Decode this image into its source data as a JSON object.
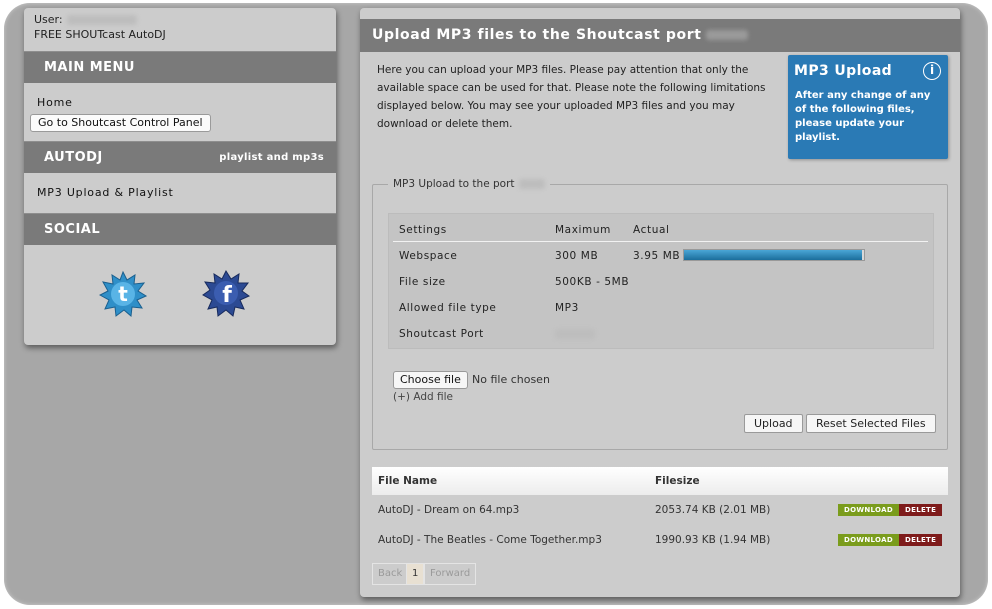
{
  "sidebar": {
    "user_label": "User:",
    "product": "FREE SHOUTcast AutoDJ",
    "main_menu_heading": "MAIN MENU",
    "home_link": "Home",
    "control_panel_button": "Go to Shoutcast Control Panel",
    "autodj_heading": "AUTODJ",
    "autodj_sub": "playlist and mp3s",
    "mp3_link": "MP3 Upload & Playlist",
    "social_heading": "SOCIAL",
    "social_icons": [
      "twitter-icon",
      "facebook-icon"
    ]
  },
  "main": {
    "title": "Upload MP3 files to the Shoutcast port",
    "intro": "Here you can upload your MP3 files. Please pay attention that only the available space can be used for that. Please note the following limitations displayed below. You may see your uploaded MP3 files and you may download or delete them.",
    "infobox": {
      "title": "MP3 Upload",
      "icon": "info-icon",
      "text": "After any change of any of the following files, please update your playlist."
    },
    "fieldset_legend": "MP3 Upload to the port",
    "settings": {
      "headers": [
        "Settings",
        "Maximum",
        "Actual"
      ],
      "webspace": {
        "label": "Webspace",
        "max": "300 MB",
        "actual": "3.95 MB",
        "usage_fraction": 0.99
      },
      "filesize": {
        "label": "File size",
        "max": "500KB - 5MB"
      },
      "filetype": {
        "label": "Allowed file type",
        "max": "MP3"
      },
      "port": {
        "label": "Shoutcast Port"
      }
    },
    "choose_file_button": "Choose file",
    "no_file_text": "No file chosen",
    "add_file": "(+) Add file",
    "upload_button": "Upload",
    "reset_button": "Reset Selected Files",
    "files": {
      "headers": [
        "File Name",
        "Filesize"
      ],
      "rows": [
        {
          "name": "AutoDJ - Dream on 64.mp3",
          "size": "2053.74 KB (2.01 MB)"
        },
        {
          "name": "AutoDJ - The Beatles - Come Together.mp3",
          "size": "1990.93 KB (1.94 MB)"
        }
      ],
      "download_label": "DOWNLOAD",
      "delete_label": "DELETE"
    },
    "pager": {
      "back": "Back",
      "page": "1",
      "forward": "Forward"
    }
  },
  "colors": {
    "header_gray": "#7a7a7a",
    "panel_bg": "#cccccc",
    "info_blue": "#2a7ab5",
    "download_green": "#7a9c1c",
    "delete_red": "#7e1b1b"
  }
}
